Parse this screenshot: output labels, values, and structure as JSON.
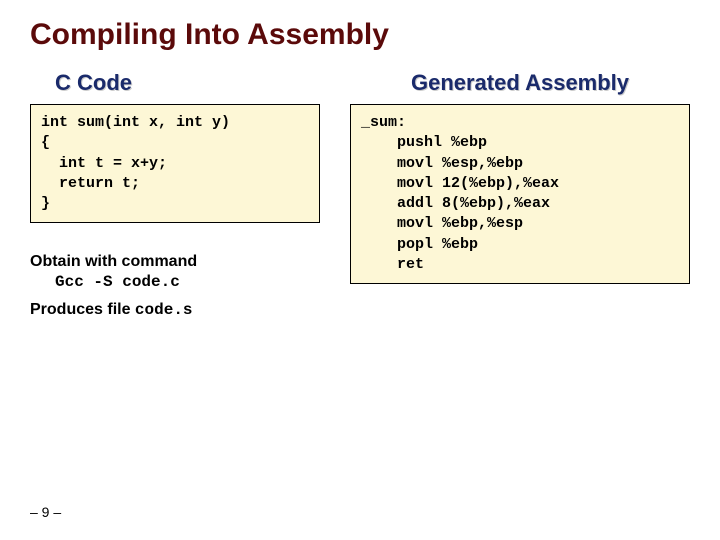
{
  "title": "Compiling Into Assembly",
  "left": {
    "heading": "C Code",
    "code": "int sum(int x, int y)\n{\n  int t = x+y;\n  return t;\n}"
  },
  "right": {
    "heading": "Generated Assembly",
    "code": "_sum:\n    pushl %ebp\n    movl %esp,%ebp\n    movl 12(%ebp),%eax\n    addl 8(%ebp),%eax\n    movl %ebp,%esp\n    popl %ebp\n    ret"
  },
  "obtain": {
    "label": "Obtain with command",
    "command": "Gcc -S code.c",
    "produces_prefix": "Produces file ",
    "produces_file": "code.s"
  },
  "pagenum": "– 9 –"
}
